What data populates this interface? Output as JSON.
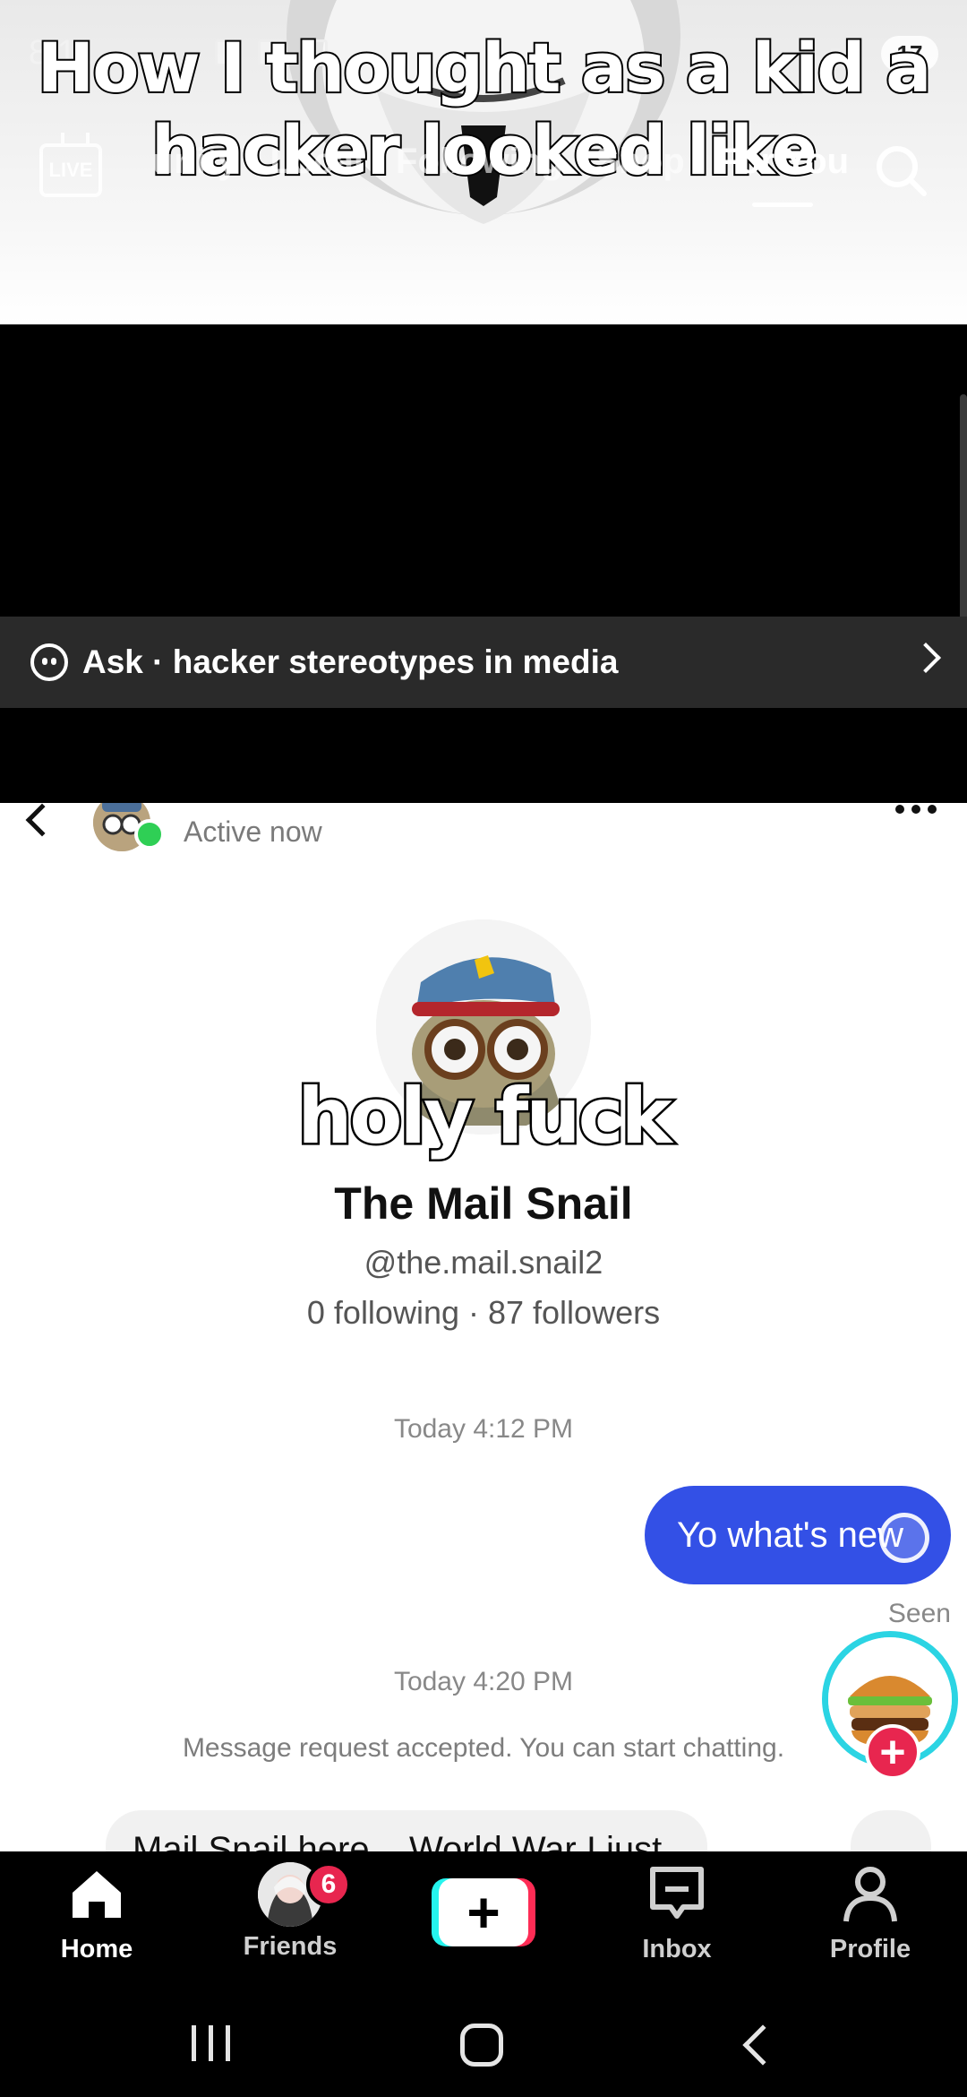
{
  "status_bar": {
    "time": "8:11",
    "battery": "17"
  },
  "video": {
    "caption": "How I thought as a kid a hacker looked like",
    "caption_line1": "How I thought as a kid a",
    "caption_line2": "hacker looked like",
    "top_nav": {
      "live_label": "LIVE",
      "tabs": [
        {
          "label": "unity"
        },
        {
          "label": "Local"
        },
        {
          "label": "Following"
        },
        {
          "label": "Shop"
        },
        {
          "label": "For You",
          "active": true
        }
      ]
    },
    "ask_bar": {
      "text": "Ask · hacker stereotypes in media"
    }
  },
  "chat": {
    "status": "Active now",
    "overlay_text": "holy fuck",
    "profile": {
      "name": "The Mail Snail",
      "handle": "@the.mail.snail2",
      "stats": "0 following · 87 followers"
    },
    "messages": {
      "timestamp_1": "Today 4:12 PM",
      "sent_bubble": "Yo what's new",
      "seen": "Seen",
      "timestamp_2": "Today 4:20 PM",
      "request_note": "Message request accepted. You can start chatting.",
      "partial_message": "Mail Snail here... World War I just"
    }
  },
  "bottom_nav": {
    "home": "Home",
    "friends": "Friends",
    "friends_badge": "6",
    "create": "+",
    "inbox": "Inbox",
    "profile": "Profile"
  },
  "colors": {
    "bubble": "#3350e6",
    "badge": "#e8264f",
    "online": "#2fcf55",
    "float_ring": "#2bd4e3"
  }
}
